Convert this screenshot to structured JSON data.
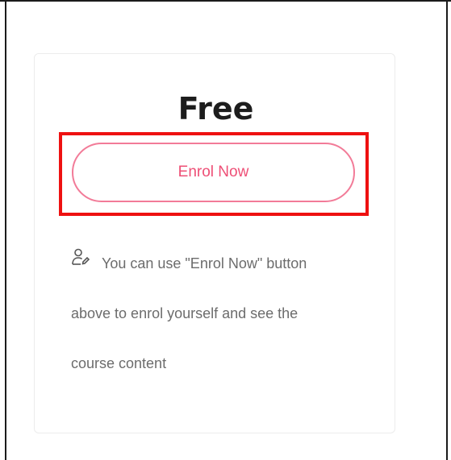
{
  "price": {
    "label": "Free"
  },
  "enrol_button": {
    "label": "Enrol Now"
  },
  "info": {
    "icon": "user-edit-icon",
    "lines": [
      "You can use \"Enrol Now\" button",
      "above to enrol yourself and see the",
      "course content"
    ]
  },
  "colors": {
    "button_border": "#f27b98",
    "button_text": "#ee4f76",
    "highlight": "#ee1111"
  }
}
